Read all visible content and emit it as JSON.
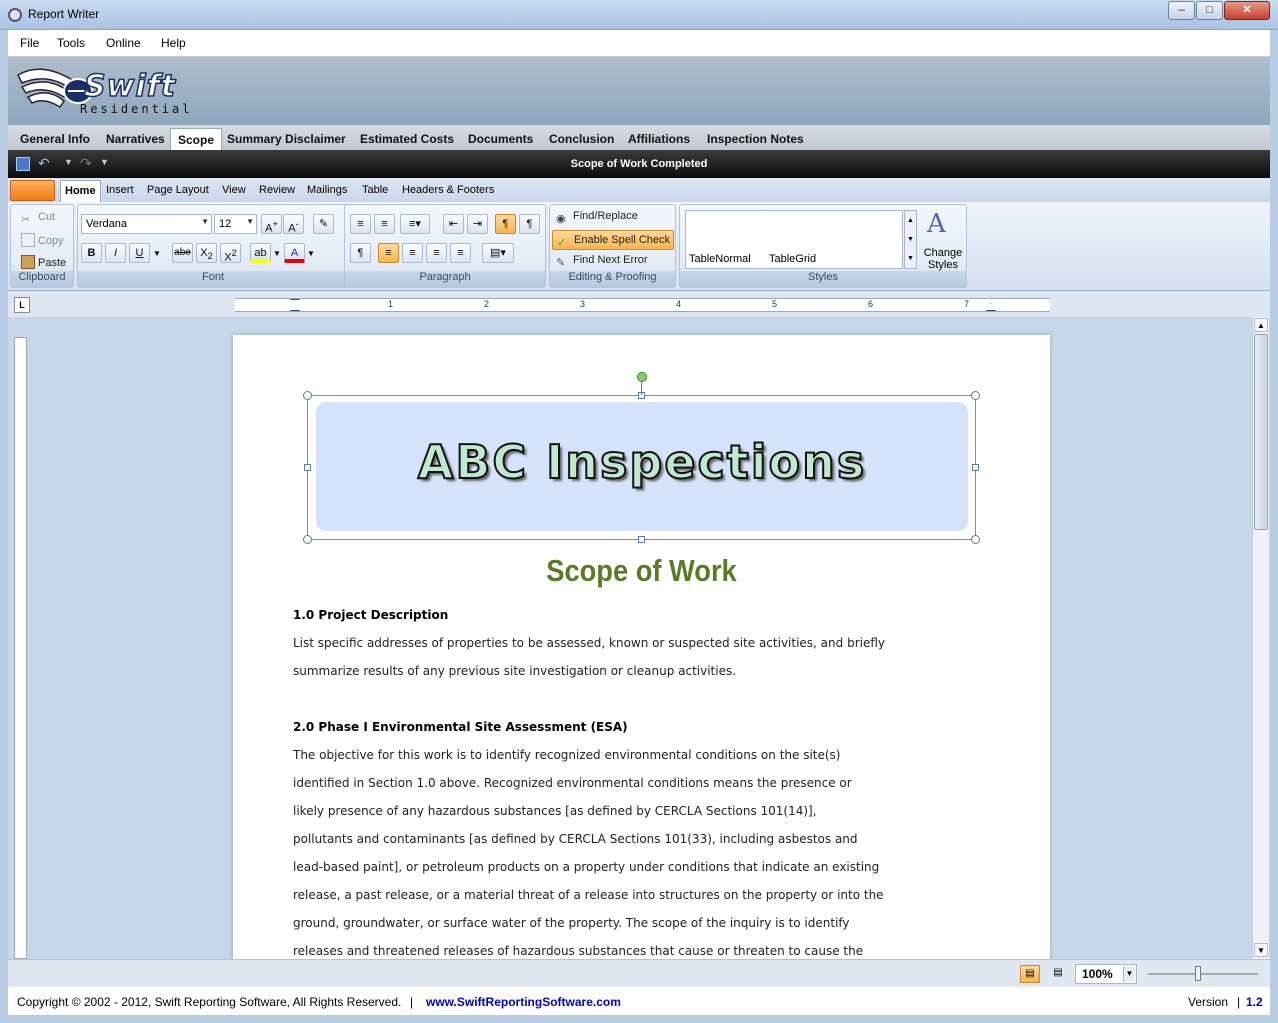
{
  "window": {
    "title": "Report Writer"
  },
  "menu": [
    "File",
    "Tools",
    "Online",
    "Help"
  ],
  "brand": {
    "name": "Swift",
    "subtitle": "Residential"
  },
  "report_tabs": [
    "General Info",
    "Narratives",
    "Scope",
    "Summary Disclaimer",
    "Estimated Costs",
    "Documents",
    "Conclusion",
    "Affiliations",
    "Inspection Notes"
  ],
  "active_report_tab": "Scope",
  "document": {
    "title": "Scope of Work Completed"
  },
  "ribbon_tabs": [
    "Home",
    "Insert",
    "Page Layout",
    "View",
    "Review",
    "Mailings",
    "Table",
    "Headers & Footers"
  ],
  "ribbon": {
    "clipboard": {
      "label": "Clipboard",
      "cut": "Cut",
      "copy": "Copy",
      "paste": "Paste"
    },
    "font": {
      "label": "Font",
      "family": "Verdana",
      "size": "12",
      "bold": "B",
      "italic": "I",
      "underline": "U",
      "strike": "abe"
    },
    "paragraph": {
      "label": "Paragraph"
    },
    "editing": {
      "label": "Editing & Proofing",
      "find_replace": "Find/Replace",
      "spell_check": "Enable Spell Check",
      "find_next_error": "Find Next Error"
    },
    "styles": {
      "label": "Styles",
      "items": [
        "TableNormal",
        "TableGrid"
      ],
      "change": "Change Styles"
    }
  },
  "ruler_numbers": [
    "1",
    "2",
    "3",
    "4",
    "5",
    "6",
    "7"
  ],
  "page": {
    "logo_text": "ABC Inspections",
    "heading": "Scope of Work",
    "lines": [
      {
        "text": "1.0 Project Description",
        "bold": true
      },
      {
        "text": "List specific addresses of properties to be assessed, known or suspected site activities, and briefly",
        "bold": false
      },
      {
        "text": "summarize results of any previous site investigation or cleanup activities.",
        "bold": false
      },
      {
        "text": "2.0 Phase I Environmental Site Assessment (ESA)",
        "bold": true
      },
      {
        "text": "The objective for this work is to identify recognized environmental conditions on the site(s)",
        "bold": false
      },
      {
        "text": "identified in Section 1.0 above.  Recognized environmental conditions means the presence or",
        "bold": false
      },
      {
        "text": "likely presence of any hazardous substances [as defined by CERCLA Sections 101(14)],",
        "bold": false
      },
      {
        "text": "pollutants and contaminants [as defined by CERCLA Sections 101(33), including asbestos and",
        "bold": false
      },
      {
        "text": "lead-based paint], or petroleum products on a property under conditions that indicate an existing",
        "bold": false
      },
      {
        "text": "release, a past release, or a material threat of a release into structures on the property or into the",
        "bold": false
      },
      {
        "text": "ground, groundwater, or surface water of the property.  The scope of the inquiry is to identify",
        "bold": false
      },
      {
        "text": "releases and threatened releases of hazardous substances that cause or threaten to cause the",
        "bold": false
      }
    ]
  },
  "status": {
    "zoom": "100%"
  },
  "footer": {
    "copyright": "Copyright © 2002 - 2012, Swift Reporting Software, All Rights Reserved.",
    "separator": "|",
    "url": "www.SwiftReportingSoftware.com",
    "version_label": "Version",
    "version_sep": "|",
    "version": "1.2"
  },
  "colors": {
    "heading": "#5a7a25",
    "accent": "#f47b17",
    "link": "#0000cc"
  }
}
